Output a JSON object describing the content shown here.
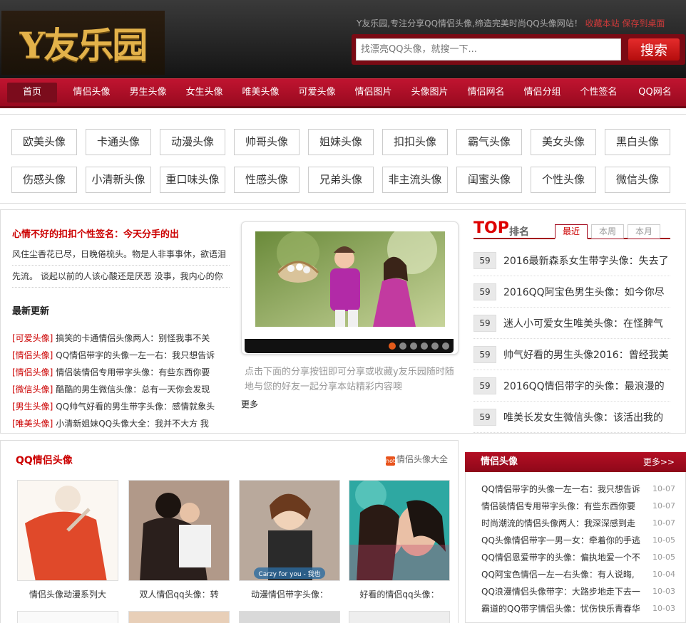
{
  "header": {
    "logo_text": "Y友乐园",
    "slogan": "Y友乐园,专注分享QQ情侣头像,缔造完美时尚QQ头像网站！",
    "bookmark_link": "收藏本站",
    "save_desktop_link": "保存到桌面",
    "search_placeholder": "找漂亮QQ头像，就搜一下...",
    "search_button": "搜索"
  },
  "nav": [
    "首页",
    "情侣头像",
    "男生头像",
    "女生头像",
    "唯美头像",
    "可爱头像",
    "情侣图片",
    "头像图片",
    "情侣网名",
    "情侣分组",
    "个性签名",
    "QQ网名"
  ],
  "tags": [
    "欧美头像",
    "卡通头像",
    "动漫头像",
    "帅哥头像",
    "姐妹头像",
    "扣扣头像",
    "霸气头像",
    "美女头像",
    "黑白头像",
    "伤感头像",
    "小清新头像",
    "重口味头像",
    "性感头像",
    "兄弟头像",
    "非主流头像",
    "闺蜜头像",
    "个性头像",
    "微信头像"
  ],
  "signature": {
    "title": "心情不好的扣扣个性签名：今天分手的出",
    "lines": [
      "风住尘香花已尽，日晚倦梳头。物是人非事事休，欲语泪",
      "先流。 谈起以前的人该心酸还是厌恶 没事，我内心的你"
    ]
  },
  "latest": {
    "heading": "最新更新",
    "items": [
      {
        "cat": "[可爱头像]",
        "title": "搞笑的卡通情侣头像两人：别怪我事不关"
      },
      {
        "cat": "[情侣头像]",
        "title": "QQ情侣带字的头像一左一右：我只想告诉"
      },
      {
        "cat": "[情侣头像]",
        "title": "情侣装情侣专用带字头像：有些东西你要"
      },
      {
        "cat": "[微信头像]",
        "title": "酷酷的男生微信头像：总有一天你会发现"
      },
      {
        "cat": "[男生头像]",
        "title": "QQ帅气好看的男生带字头像：感情就象头"
      },
      {
        "cat": "[唯美头像]",
        "title": "小清新姐妹QQ头像大全：我并不大方 我"
      }
    ]
  },
  "slider": {
    "share_text": "点击下面的分享按钮即可分享或收藏y友乐园随时随地与您的好友一起分享本站精彩内容噢",
    "more": "更多"
  },
  "top": {
    "title": "TOP",
    "subtitle": "排名",
    "tabs": [
      "最近",
      "本周",
      "本月"
    ],
    "items": [
      {
        "n": "59",
        "t": "2016最新森系女生带字头像：失去了"
      },
      {
        "n": "59",
        "t": "2016QQ阿宝色男生头像：如今你尽"
      },
      {
        "n": "59",
        "t": "迷人小可爱女生唯美头像：在怪脾气"
      },
      {
        "n": "59",
        "t": "帅气好看的男生头像2016：曾经我美"
      },
      {
        "n": "59",
        "t": "2016QQ情侣带字的头像：最浪漫的"
      },
      {
        "n": "59",
        "t": "唯美长发女生微信头像：该活出我的"
      }
    ]
  },
  "qq": {
    "title": "QQ情侣头像",
    "hot": "hot",
    "more": "情侣头像大全",
    "thumbs": [
      {
        "cap": "情侣头像动漫系列大"
      },
      {
        "cap": "双人情侣qq头像：转"
      },
      {
        "cap": "动漫情侣带字头像："
      },
      {
        "cap": "好看的情侣qq头像："
      }
    ],
    "overlay_text": "Carzy for you - 我也"
  },
  "side": {
    "title": "情侣头像",
    "more": "更多>>",
    "items": [
      {
        "t": "QQ情侣带字的头像一左一右：我只想告诉",
        "d": "10-07"
      },
      {
        "t": "情侣装情侣专用带字头像：有些东西你要",
        "d": "10-07"
      },
      {
        "t": "时尚潮流的情侣头像两人：我深深感到走",
        "d": "10-07"
      },
      {
        "t": "QQ头像情侣带字一男一女：牵着你的手逃",
        "d": "10-05"
      },
      {
        "t": "QQ情侣恩爱带字的头像：偏执地爱一个不",
        "d": "10-05"
      },
      {
        "t": "QQ阿宝色情侣一左一右头像：有人说晦,",
        "d": "10-04"
      },
      {
        "t": "QQ浪漫情侣头像带字：大路步地走下去一",
        "d": "10-03"
      },
      {
        "t": "霸道的QQ带字情侣头像：忧伤快乐青春华",
        "d": "10-03"
      }
    ]
  }
}
